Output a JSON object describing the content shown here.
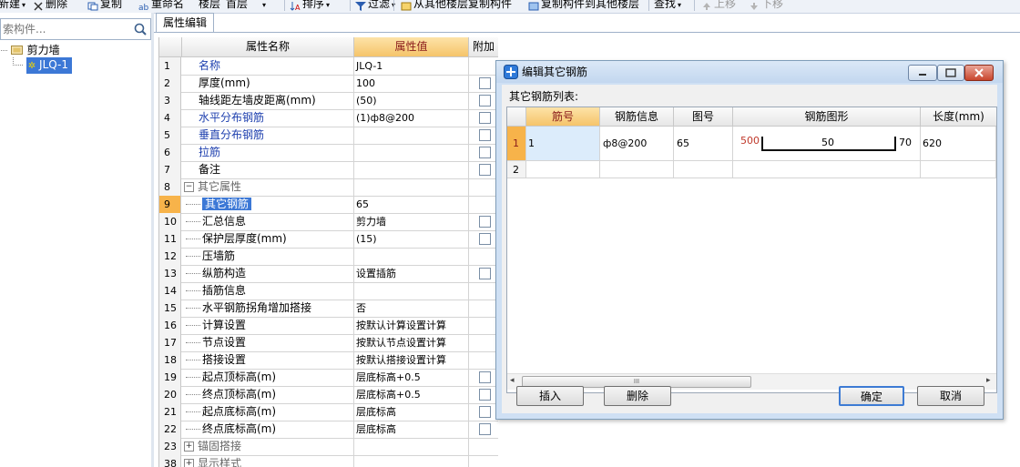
{
  "toolbar": {
    "items": [
      "新建",
      "删除",
      "复制",
      "重命名",
      "楼层",
      "首层",
      "排序",
      "过滤",
      "从其他楼层复制构件",
      "复制构件到其他楼层",
      "查找",
      "上移",
      "下移"
    ]
  },
  "left_panel": {
    "search_placeholder": "索构件...",
    "tree": {
      "root_label": "剪力墙",
      "child_label": "JLQ-1"
    }
  },
  "property_panel": {
    "tab_label": "属性编辑",
    "headers": {
      "name": "属性名称",
      "value": "属性值",
      "extra": "附加"
    },
    "rows": [
      {
        "num": "1",
        "name": "名称",
        "value": "JLQ-1"
      },
      {
        "num": "2",
        "name": "厚度(mm)",
        "value": "100"
      },
      {
        "num": "3",
        "name": "轴线距左墙皮距离(mm)",
        "value": "(50)"
      },
      {
        "num": "4",
        "name": "水平分布钢筋",
        "value": "(1)ф8@200"
      },
      {
        "num": "5",
        "name": "垂直分布钢筋",
        "value": ""
      },
      {
        "num": "6",
        "name": "拉筋",
        "value": ""
      },
      {
        "num": "7",
        "name": "备注",
        "value": ""
      },
      {
        "num": "8",
        "name": "其它属性",
        "value": ""
      },
      {
        "num": "9",
        "name": "其它钢筋",
        "value": "65"
      },
      {
        "num": "10",
        "name": "汇总信息",
        "value": "剪力墙"
      },
      {
        "num": "11",
        "name": "保护层厚度(mm)",
        "value": "(15)"
      },
      {
        "num": "12",
        "name": "压墙筋",
        "value": ""
      },
      {
        "num": "13",
        "name": "纵筋构造",
        "value": "设置插筋"
      },
      {
        "num": "14",
        "name": "插筋信息",
        "value": ""
      },
      {
        "num": "15",
        "name": "水平钢筋拐角增加搭接",
        "value": "否"
      },
      {
        "num": "16",
        "name": "计算设置",
        "value": "按默认计算设置计算"
      },
      {
        "num": "17",
        "name": "节点设置",
        "value": "按默认节点设置计算"
      },
      {
        "num": "18",
        "name": "搭接设置",
        "value": "按默认搭接设置计算"
      },
      {
        "num": "19",
        "name": "起点顶标高(m)",
        "value": "层底标高+0.5"
      },
      {
        "num": "20",
        "name": "终点顶标高(m)",
        "value": "层底标高+0.5"
      },
      {
        "num": "21",
        "name": "起点底标高(m)",
        "value": "层底标高"
      },
      {
        "num": "22",
        "name": "终点底标高(m)",
        "value": "层底标高"
      },
      {
        "num": "23",
        "name": "锚固搭接",
        "value": ""
      },
      {
        "num": "38",
        "name": "显示样式",
        "value": ""
      }
    ]
  },
  "dialog": {
    "title": "编辑其它钢筋",
    "list_label": "其它钢筋列表:",
    "headers": [
      "筋号",
      "钢筋信息",
      "图号",
      "钢筋图形",
      "长度(mm)"
    ],
    "rows": [
      {
        "num": "1",
        "bar_no": "1",
        "info": "ф8@200",
        "figure_no": "65",
        "shape_left": "500",
        "shape_mid": "50",
        "shape_right": "70",
        "length": "620"
      },
      {
        "num": "2",
        "bar_no": "",
        "info": "",
        "figure_no": "",
        "shape_left": "",
        "shape_mid": "",
        "shape_right": "",
        "length": ""
      }
    ],
    "buttons": {
      "insert": "插入",
      "delete": "删除",
      "ok": "确定",
      "cancel": "取消"
    },
    "scroll_grip": "III"
  },
  "colors": {
    "selection_orange": "#f7b34a",
    "selection_blue": "#3c78d6",
    "label_blue": "#1d3fae",
    "dim_red": "#c0392b"
  }
}
